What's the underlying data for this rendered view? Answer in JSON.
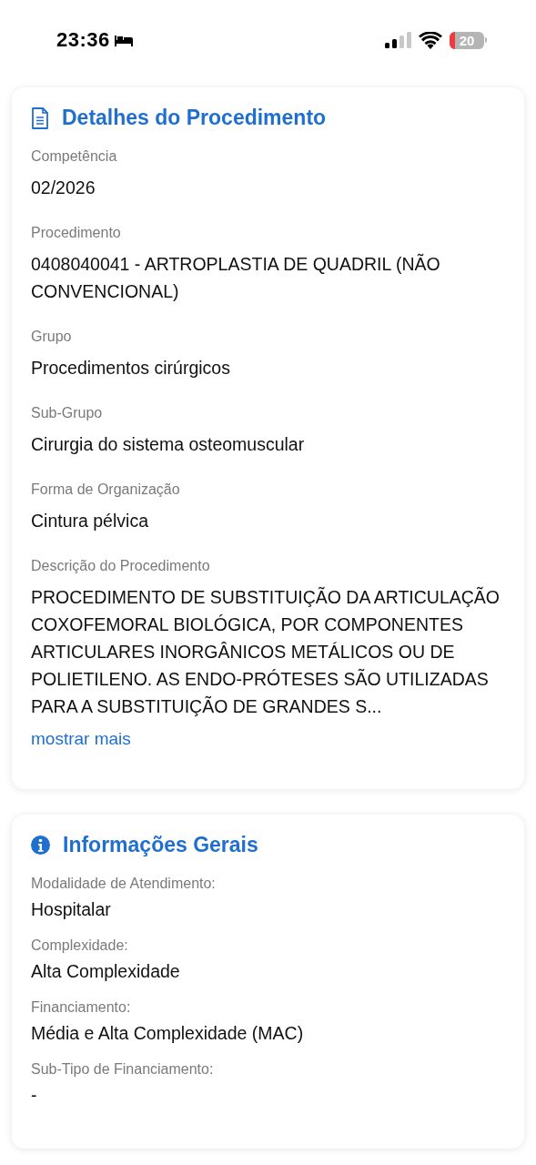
{
  "status_bar": {
    "time": "23:36",
    "battery": "20"
  },
  "cards": [
    {
      "kind": "details",
      "title": "Detalhes do Procedimento",
      "fields": [
        {
          "label": "Competência",
          "value": "02/2026"
        },
        {
          "label": "Procedimento",
          "value": "0408040041 - ARTROPLASTIA DE QUADRIL (NÃO CONVENCIONAL)"
        },
        {
          "label": "Grupo",
          "value": "Procedimentos cirúrgicos"
        },
        {
          "label": "Sub-Grupo",
          "value": "Cirurgia do sistema osteomuscular"
        },
        {
          "label": "Forma de Organização",
          "value": "Cintura pélvica"
        },
        {
          "label": "Descrição do Procedimento",
          "value": "PROCEDIMENTO DE SUBSTITUIÇÃO DA ARTICULAÇÃO COXOFEMORAL BIOLÓGICA, POR COMPONENTES ARTICULARES INORGÂNICOS METÁLICOS OU DE POLIETILENO. AS ENDO-PRÓTESES SÃO UTILIZADAS PARA A SUBSTITUIÇÃO DE GRANDES S..."
        }
      ],
      "link": "mostrar mais"
    },
    {
      "kind": "info",
      "title": "Informações Gerais",
      "fields": [
        {
          "label": "Modalidade de Atendimento:",
          "value": "Hospitalar"
        },
        {
          "label": "Complexidade:",
          "value": "Alta Complexidade"
        },
        {
          "label": "Financiamento:",
          "value": "Média e Alta Complexidade (MAC)"
        },
        {
          "label": "Sub-Tipo de Financiamento:",
          "value": "-"
        }
      ]
    }
  ]
}
